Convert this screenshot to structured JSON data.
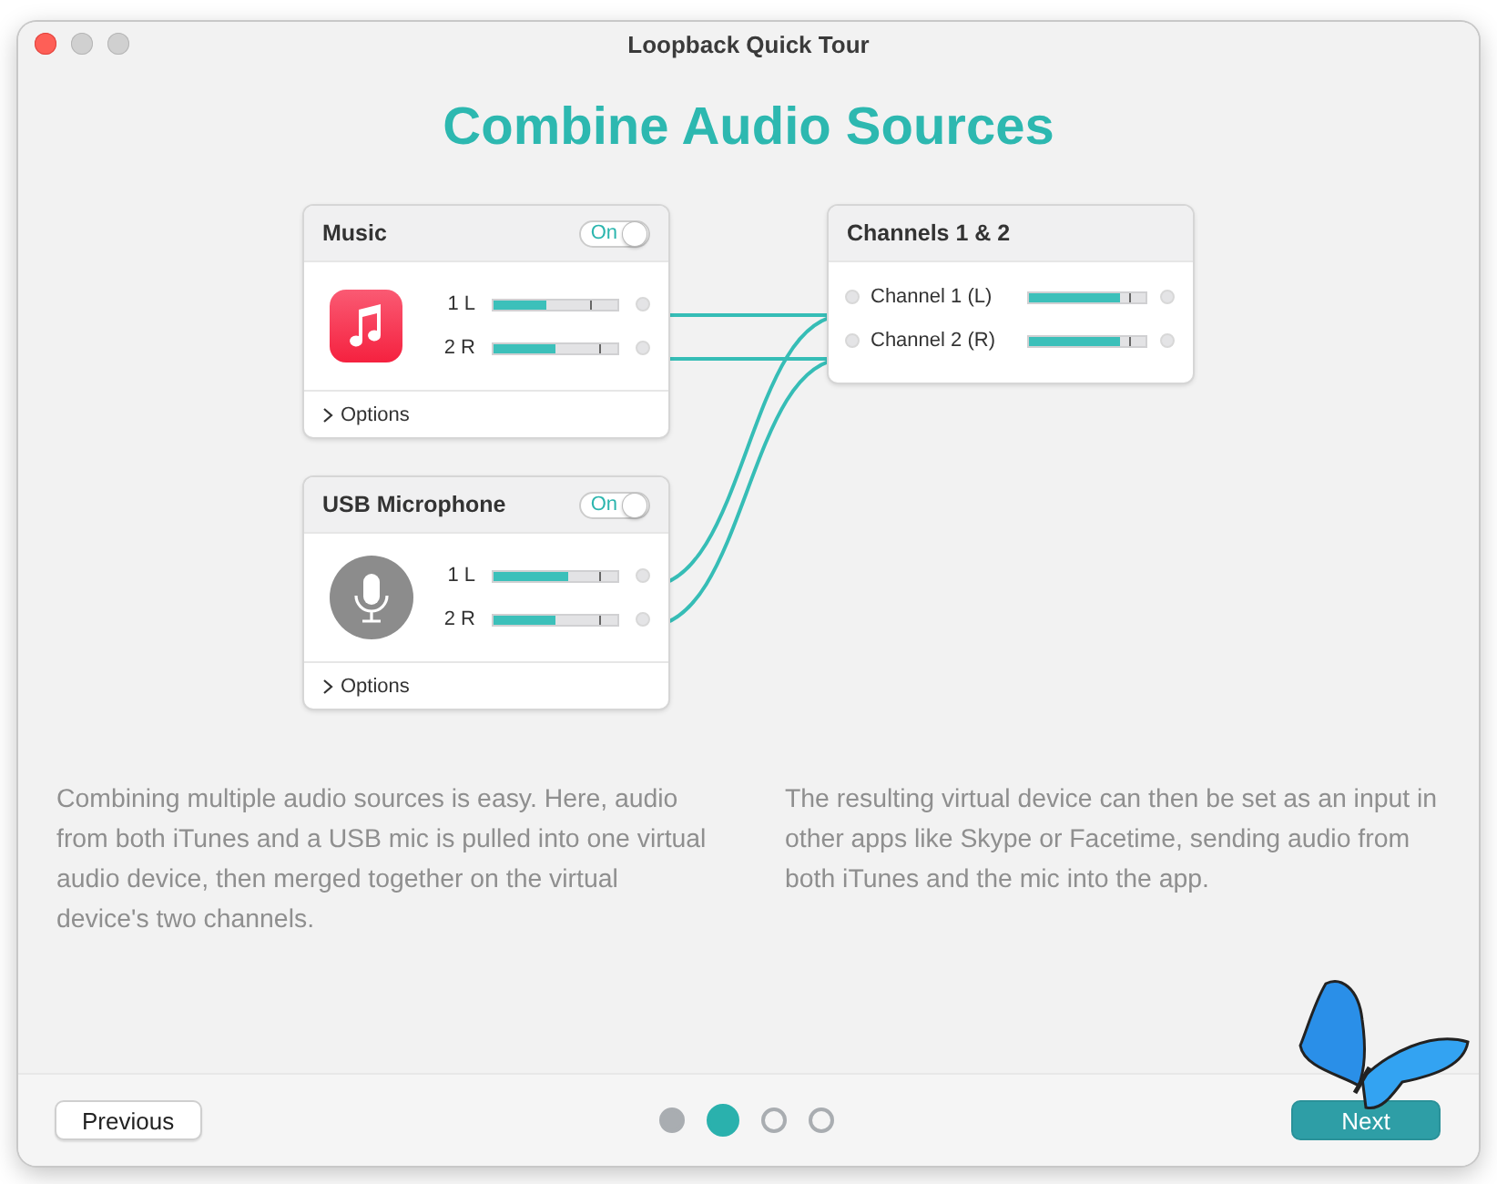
{
  "window": {
    "title": "Loopback Quick Tour"
  },
  "heading": "Combine Audio Sources",
  "sources": [
    {
      "name": "Music",
      "kind": "music",
      "toggle": {
        "label": "On",
        "on": true
      },
      "channels": [
        {
          "label": "1 L",
          "level": 0.43
        },
        {
          "label": "2 R",
          "level": 0.5
        }
      ],
      "options": "Options"
    },
    {
      "name": "USB Microphone",
      "kind": "microphone",
      "toggle": {
        "label": "On",
        "on": true
      },
      "channels": [
        {
          "label": "1 L",
          "level": 0.6
        },
        {
          "label": "2 R",
          "level": 0.5
        }
      ],
      "options": "Options"
    }
  ],
  "output": {
    "name": "Channels 1 & 2",
    "channels": [
      {
        "label": "Channel 1 (L)",
        "level": 0.78
      },
      {
        "label": "Channel 2 (R)",
        "level": 0.78
      }
    ]
  },
  "paragraphs": [
    "Combining multiple audio sources is easy. Here, audio from both iTunes and a USB mic is pulled into one virtual audio device, then merged together on the virtual device's two channels.",
    "The resulting virtual device can then be set as an input in other apps like Skype or Facetime, sending audio from both iTunes and the mic into the app."
  ],
  "footer": {
    "previous": "Previous",
    "next": "Next",
    "pages": [
      {
        "selected": false,
        "visited": true
      },
      {
        "selected": true,
        "visited": true
      },
      {
        "selected": false,
        "visited": false
      },
      {
        "selected": false,
        "visited": false
      }
    ]
  }
}
